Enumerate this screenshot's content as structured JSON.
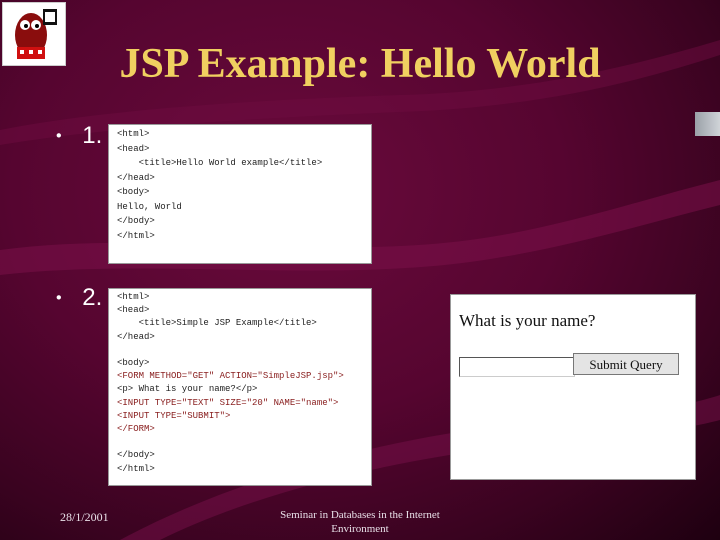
{
  "slide": {
    "title": "JSP Example: Hello World",
    "bullets": [
      {
        "label": "1."
      },
      {
        "label": "2."
      }
    ]
  },
  "code_example_1": {
    "lines": [
      "<html>",
      "<head>",
      "    <title>Hello World example</title>",
      "</head>",
      "<body>",
      "Hello, World",
      "</body>",
      "</html>"
    ]
  },
  "code_example_2": {
    "lines": [
      "<html>",
      "<head>",
      "    <title>Simple JSP Example</title>",
      "</head>",
      "",
      "<body>",
      "<FORM METHOD=\"GET\" ACTION=\"SimpleJSP.jsp\">",
      "<p> What is your name?</p>",
      "<INPUT TYPE=\"TEXT\" SIZE=\"20\" NAME=\"name\">",
      "<INPUT TYPE=\"SUBMIT\">",
      "</FORM>",
      "",
      "</body>",
      "</html>"
    ]
  },
  "form_preview": {
    "question": "What is your name?",
    "input_value": "",
    "submit_label": "Submit Query"
  },
  "footer": {
    "date": "28/1/2001",
    "center_line1": "Seminar in Databases in the Internet",
    "center_line2": "Environment"
  },
  "colors": {
    "background": "#560530",
    "title": "#f0d060",
    "text": "#ffffff"
  }
}
